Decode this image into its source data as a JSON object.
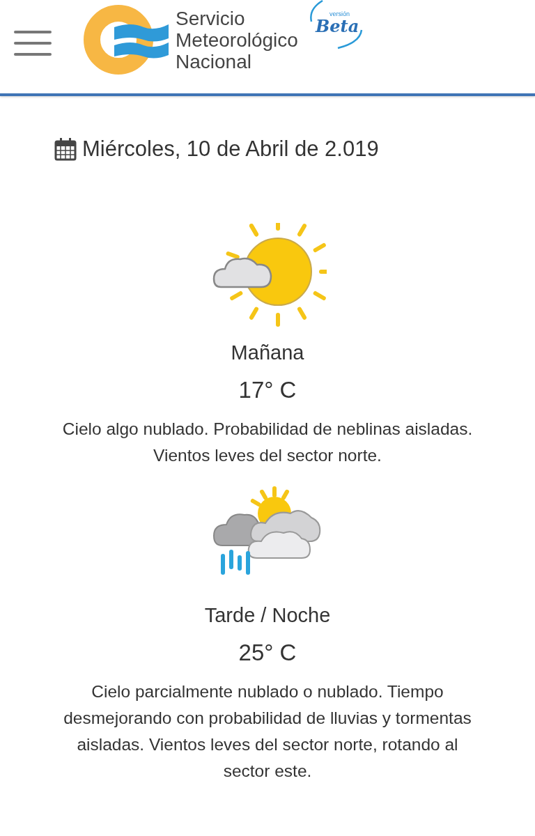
{
  "header": {
    "logo_lines": [
      "Servicio",
      "Meteorológico",
      "Nacional"
    ],
    "badge_small": "versión",
    "badge": "Beta"
  },
  "date": "Miércoles, 10 de Abril de 2.019",
  "forecasts": [
    {
      "kind": "partly-cloudy",
      "period": "Mañana",
      "temperature": "17° C",
      "description": "Cielo algo nublado. Probabilidad de neblinas aisladas. Vientos leves del sector norte."
    },
    {
      "kind": "storm",
      "period": "Tarde / Noche",
      "temperature": "25° C",
      "description": "Cielo parcialmente nublado o nublado. Tiempo desmejorando con probabilidad de lluvias y tormentas aisladas. Vientos leves del sector norte, rotando al sector este."
    }
  ]
}
